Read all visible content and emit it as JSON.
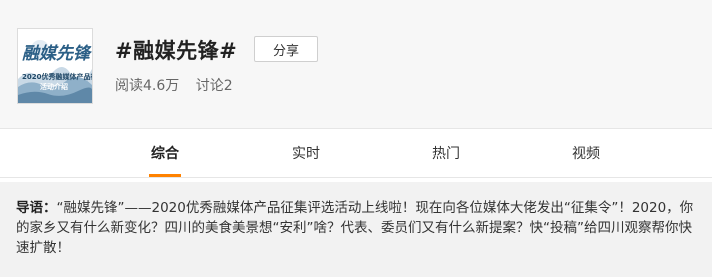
{
  "topic": {
    "title": "#融媒先锋#",
    "cover_text": {
      "main": "融媒先锋",
      "line1": "2020优秀融媒体产品征集",
      "line2": "活动介绍"
    },
    "share_label": "分享",
    "read_count": "阅读4.6万",
    "discussion_count": "讨论2"
  },
  "tabs": [
    {
      "label": "综合",
      "active": true
    },
    {
      "label": "实时",
      "active": false
    },
    {
      "label": "热门",
      "active": false
    },
    {
      "label": "视频",
      "active": false
    }
  ],
  "guide": {
    "label": "导语：",
    "text": "“融媒先锋”——2020优秀融媒体产品征集评选活动上线啦！现在向各位媒体大佬发出“征集令”！2020，你的家乡又有什么新变化？四川的美食美景想“安利”啥？代表、委员们又有什么新提案？快“投稿”给四川观察帮你快速扩散！"
  },
  "colors": {
    "accent": "#ff8200",
    "header_bg": "#f7f7f7",
    "guide_bg": "#f2f2f2",
    "cover_ink": "#2b5f86"
  }
}
